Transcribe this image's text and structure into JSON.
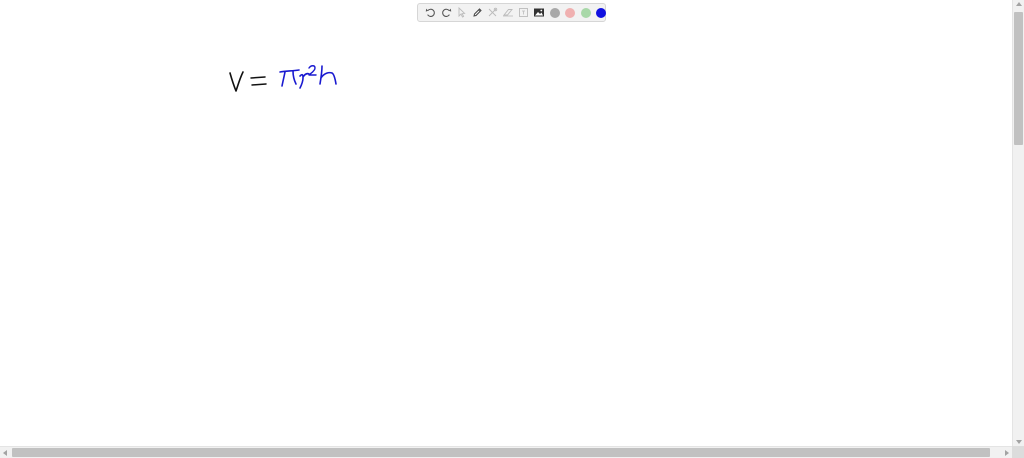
{
  "toolbar": {
    "tools": [
      {
        "name": "undo-icon",
        "enabled": true
      },
      {
        "name": "redo-icon",
        "enabled": true
      },
      {
        "name": "select-pointer-icon",
        "enabled": false
      },
      {
        "name": "pen-icon",
        "enabled": true
      },
      {
        "name": "scissors-tools-icon",
        "enabled": false
      },
      {
        "name": "eraser-icon",
        "enabled": false
      },
      {
        "name": "text-box-icon",
        "enabled": false
      },
      {
        "name": "image-icon",
        "enabled": true
      }
    ],
    "colors": [
      {
        "name": "color-gray",
        "hex": "#a8a8a8"
      },
      {
        "name": "color-red",
        "hex": "#f0b0b0"
      },
      {
        "name": "color-green",
        "hex": "#a8d8a8"
      },
      {
        "name": "color-blue",
        "hex": "#1010e0",
        "selected": true
      }
    ]
  },
  "canvas": {
    "handwritten_text": [
      {
        "text": "V =",
        "color": "#111111"
      },
      {
        "text": "πr²h",
        "color": "#1a1ad0"
      }
    ]
  },
  "colors": {
    "ink_black": "#111111",
    "ink_blue": "#1a1ad0",
    "toolbar_bg": "#f2f2f2"
  }
}
